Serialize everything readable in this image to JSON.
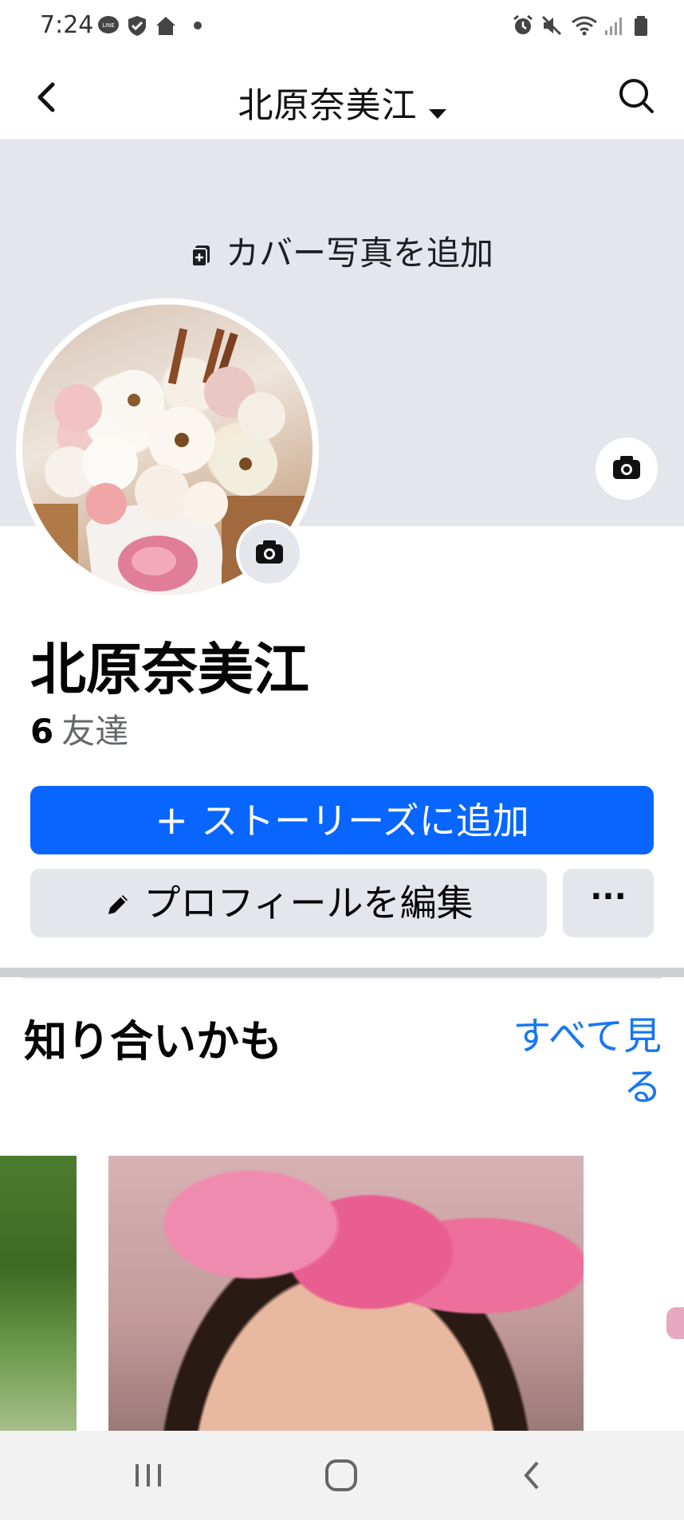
{
  "status_bar": {
    "time": "7:24",
    "left_icons": [
      "line-icon",
      "shield-check-icon",
      "home-icon",
      "dot-icon"
    ],
    "right_icons": [
      "alarm-icon",
      "mute-icon",
      "wifi-icon",
      "signal-icon",
      "battery-icon"
    ]
  },
  "header": {
    "title": "北原奈美江"
  },
  "cover": {
    "add_cover_label": "カバー写真を追加"
  },
  "profile": {
    "name": "北原奈美江",
    "friends_count": "6",
    "friends_label": "友達"
  },
  "actions": {
    "add_story_label": "ストーリーズに追加",
    "edit_profile_label": "プロフィールを編集",
    "more_label": "···"
  },
  "people_you_may_know": {
    "title": "知り合いかも",
    "see_all_label": "すべて見る"
  },
  "colors": {
    "primary": "#0866ff",
    "link": "#1877f2",
    "secondary_button": "#e4e6eb",
    "cover_bg": "#e4e6eb"
  }
}
